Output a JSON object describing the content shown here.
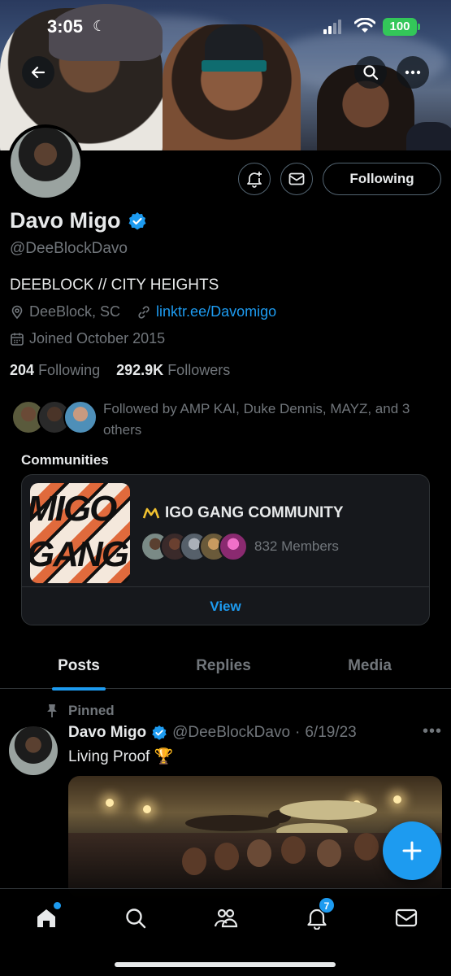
{
  "status_bar": {
    "time": "3:05",
    "battery": "100"
  },
  "profile": {
    "name": "Davo Migo",
    "handle": "@DeeBlockDavo",
    "bio": "DEEBLOCK // CITY HEIGHTS",
    "location": "DeeBlock, SC",
    "link": "linktr.ee/Davomigo",
    "joined": "Joined October 2015",
    "following_count": "204",
    "following_label": "Following",
    "followers_count": "292.9K",
    "followers_label": "Followers",
    "followed_by": "Followed by AMP KAI, Duke Dennis, MAYZ, and 3 others",
    "follow_button": "Following"
  },
  "communities": {
    "title": "Communities",
    "name": "IGO GANG COMMUNITY",
    "image_text": "MIGO GANG",
    "members": "832 Members",
    "view_label": "View"
  },
  "tabs": [
    {
      "label": "Posts",
      "active": true
    },
    {
      "label": "Replies",
      "active": false
    },
    {
      "label": "Media",
      "active": false
    }
  ],
  "post": {
    "pinned_label": "Pinned",
    "name": "Davo Migo",
    "handle": "@DeeBlockDavo",
    "separator": "·",
    "date": "6/19/23",
    "text": "Living Proof 🏆"
  },
  "bottom_nav": {
    "notifications_badge": "7",
    "items": [
      "home-icon",
      "search-icon",
      "communities-icon",
      "notifications-icon",
      "messages-icon"
    ]
  },
  "colors": {
    "accent": "#1d9bf0",
    "background": "#000000",
    "text_primary": "#e7e9ea",
    "text_secondary": "#71767b",
    "verified": "#1d9bf0",
    "battery": "#33c759"
  }
}
